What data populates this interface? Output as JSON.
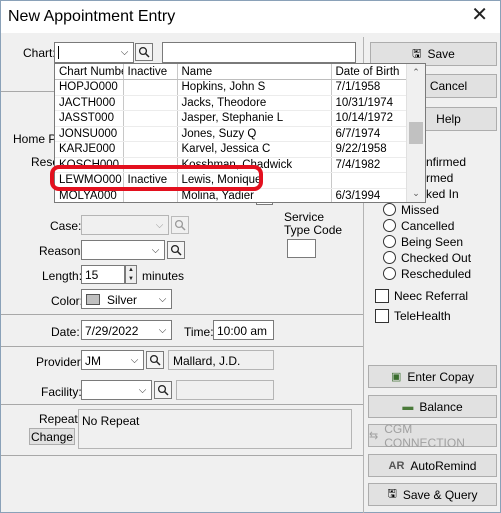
{
  "window": {
    "title": "New Appointment Entry"
  },
  "chart": {
    "label": "Chart:",
    "value": "",
    "name_value": ""
  },
  "chart_list": {
    "columns": [
      "Chart Number",
      "Inactive",
      "Name",
      "Date of Birth"
    ],
    "rows": [
      [
        "HOPJO000",
        "",
        "Hopkins, John S",
        "7/1/1958"
      ],
      [
        "JACTH000",
        "",
        "Jacks, Theodore",
        "10/31/1974"
      ],
      [
        "JASST000",
        "",
        "Jasper, Stephanie L",
        "10/14/1972"
      ],
      [
        "JONSU000",
        "",
        "Jones, Suzy Q",
        "6/7/1974"
      ],
      [
        "KARJE000",
        "",
        "Karvel, Jessica C",
        "9/22/1958"
      ],
      [
        "KOSCH000",
        "",
        "Kosshman, Chadwick",
        "7/4/1982"
      ],
      [
        "LEWMO000",
        "Inactive",
        "Lewis, Monique",
        ""
      ],
      [
        "MOLYA000",
        "",
        "Molina, Yadier",
        "6/3/1994"
      ]
    ]
  },
  "left_partial_labels": {
    "home_phone": "Home Ph",
    "resource": "Reso"
  },
  "case": {
    "label": "Case:"
  },
  "reason": {
    "label": "Reason:"
  },
  "service_type": {
    "label_line1": "Service",
    "label_line2": "Type Code"
  },
  "length": {
    "label": "Length:",
    "value": "15",
    "unit": "minutes"
  },
  "color": {
    "label": "Color:",
    "value": "Silver",
    "swatch": "#c0c0c0"
  },
  "date": {
    "label": "Date:",
    "value": "7/29/2022"
  },
  "time": {
    "label": "Time:",
    "value": "10:00 am"
  },
  "provider": {
    "label": "Provider:",
    "value": "JM",
    "name": "Mallard, J.D."
  },
  "facility": {
    "label": "Facility:"
  },
  "repeat": {
    "label": "Repeat:",
    "value": "No Repeat",
    "change_label": "Change"
  },
  "status": {
    "partial": [
      "nfirmed",
      "rmed",
      "ked In"
    ],
    "items": [
      "Missed",
      "Cancelled",
      "Being Seen",
      "Checked Out",
      "Rescheduled"
    ]
  },
  "checks": {
    "need_referral": "Neec Referral",
    "telehealth": "TeleHealth"
  },
  "buttons": {
    "save": "Save",
    "cancel": "Cancel",
    "help": "Help",
    "enter_copay": "Enter Copay",
    "balance": "Balance",
    "cgm": "CGM CONNECTION",
    "autoremind": "AutoRemind",
    "autoremind_prefix": "AR",
    "save_query": "Save & Query"
  }
}
